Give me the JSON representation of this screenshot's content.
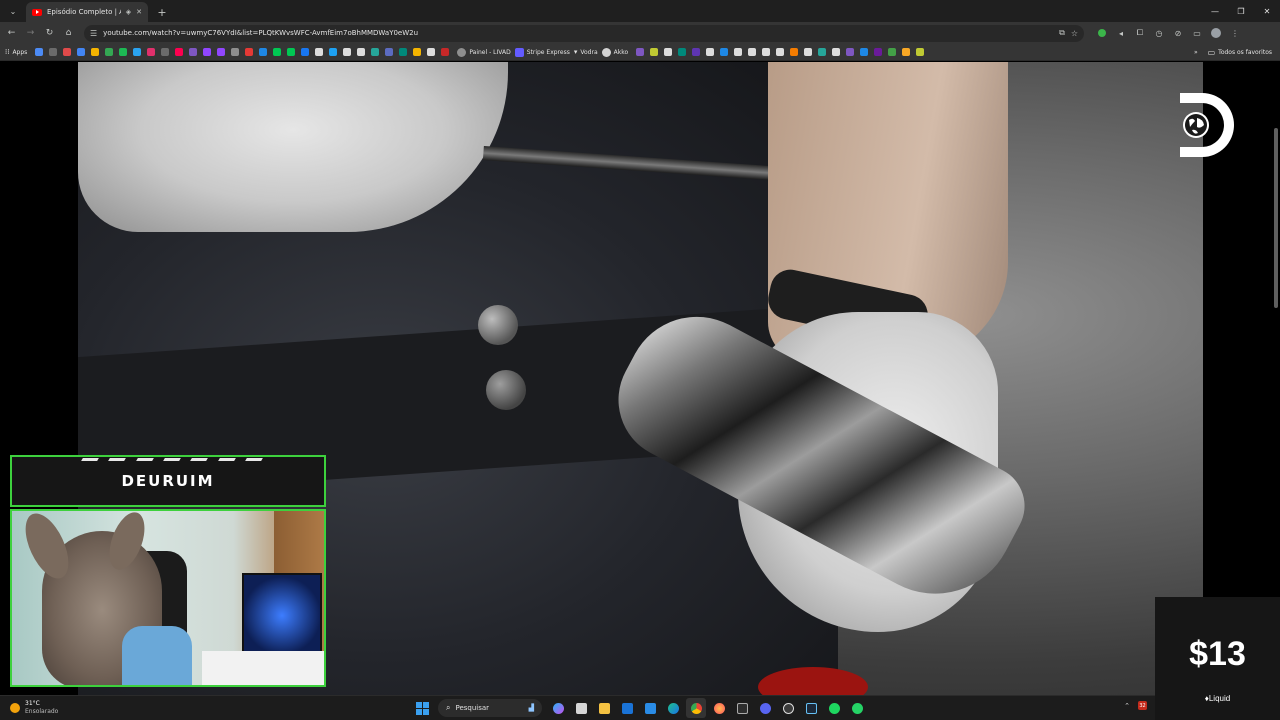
{
  "browser": {
    "tab": {
      "title": "Episódio Completo | Aerop"
    },
    "url": "youtube.com/watch?v=uwmyC76VYdI&list=PLQtKWvsWFC-AvmfEim7oBhMMDWaY0eW2u",
    "colors": {
      "tabstrip": "#1f1f1f",
      "toolbar": "#353535",
      "omnibox": "#282828"
    }
  },
  "bookmarks": {
    "apps_label": "Apps",
    "items": [
      {
        "label": "Painel - LIVAD",
        "color": "#8f8f8f"
      },
      {
        "label": "Stripe Express",
        "color": "#635bff"
      },
      {
        "label": "Vodra",
        "color": "#d4d4d4"
      },
      {
        "label": "Akko",
        "color": "#d4d4d4"
      }
    ],
    "all_label": "Todos os favoritos"
  },
  "video": {
    "channel_logo": "discovery-globe-logo"
  },
  "webcam": {
    "streamer_name": "DEURUIM",
    "accent": "#3dd13d"
  },
  "price_widget": {
    "amount": "$13",
    "brand": "Liquid"
  },
  "taskbar": {
    "weather_temp": "31°C",
    "weather_condition": "Ensolarado",
    "search_placeholder": "Pesquisar",
    "tray_badge": "32"
  }
}
